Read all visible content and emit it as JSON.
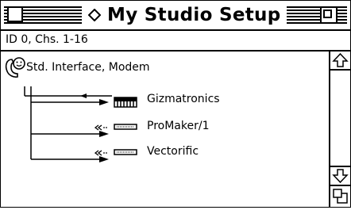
{
  "window": {
    "title": "My Studio Setup"
  },
  "info_bar": {
    "text": "ID 0, Chs. 1-16"
  },
  "port": {
    "label": "Std. Interface, Modem",
    "icon": "modem-port-icon"
  },
  "devices": [
    {
      "label": "Gizmatronics",
      "icon": "keyboard-icon",
      "connection": "input-output"
    },
    {
      "label": "ProMaker/1",
      "icon": "module-icon",
      "connection": "output-only"
    },
    {
      "label": "Vectorific",
      "icon": "module-icon",
      "connection": "output-only"
    }
  ],
  "scrollbar": {
    "up_icon": "up-arrow-icon",
    "down_icon": "down-arrow-icon",
    "grow_icon": "grow-box-icon"
  }
}
